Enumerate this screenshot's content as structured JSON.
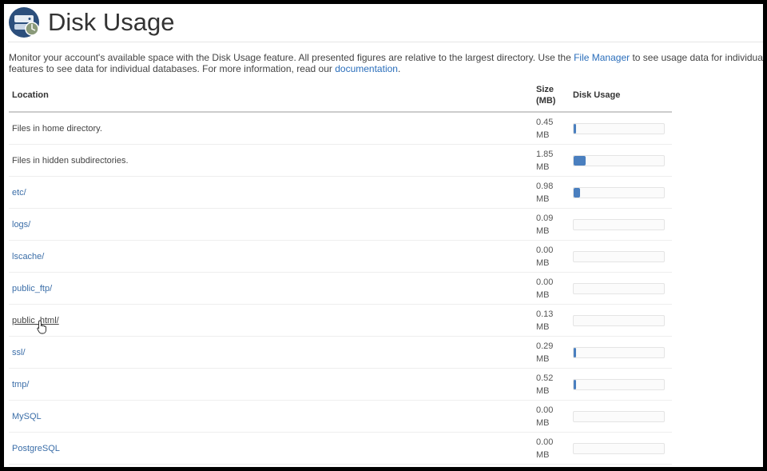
{
  "header": {
    "title": "Disk Usage",
    "logo_icon": "disk-usage-icon"
  },
  "description": {
    "part1": "Monitor your account's available space with the Disk Usage feature. All presented figures are relative to the largest directory. Use the ",
    "link1": "File Manager",
    "part2": " to see usage data for individual files and",
    "line2_part1": "features to see data for individual databases. For more information, read our ",
    "link2": "documentation",
    "line2_part2": "."
  },
  "table": {
    "headers": {
      "location": "Location",
      "size_line1": "Size",
      "size_line2": "(MB)",
      "usage": "Disk Usage"
    },
    "unit": "MB",
    "rows": [
      {
        "location": "Files in home directory.",
        "link": false,
        "size": "0.45",
        "fraction": 0.03
      },
      {
        "location": "Files in hidden subdirectories.",
        "link": false,
        "size": "1.85",
        "fraction": 0.13
      },
      {
        "location": "etc/",
        "link": true,
        "size": "0.98",
        "fraction": 0.07
      },
      {
        "location": "logs/",
        "link": true,
        "size": "0.09",
        "fraction": 0.0
      },
      {
        "location": "lscache/",
        "link": true,
        "size": "0.00",
        "fraction": 0.0
      },
      {
        "location": "public_ftp/",
        "link": true,
        "size": "0.00",
        "fraction": 0.0
      },
      {
        "location": "public_html/",
        "link": true,
        "size": "0.13",
        "fraction": 0.0,
        "hover": true
      },
      {
        "location": "ssl/",
        "link": true,
        "size": "0.29",
        "fraction": 0.02
      },
      {
        "location": "tmp/",
        "link": true,
        "size": "0.52",
        "fraction": 0.03
      },
      {
        "location": "MySQL",
        "link": true,
        "size": "0.00",
        "fraction": 0.0
      },
      {
        "location": "PostgreSQL",
        "link": true,
        "size": "0.00",
        "fraction": 0.0
      }
    ]
  },
  "colors": {
    "bar_fill": "#4a7fbf",
    "link": "#3b6ea8"
  }
}
